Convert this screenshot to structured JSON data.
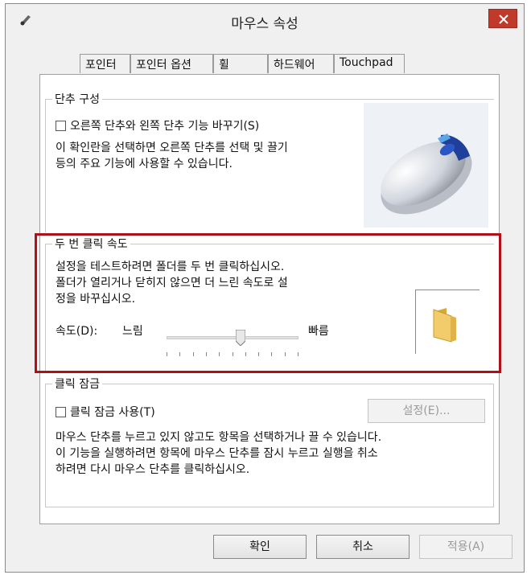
{
  "window": {
    "title": "마우스 속성"
  },
  "tabs": [
    "포인터",
    "포인터 옵션",
    "휠",
    "하드웨어",
    "Touchpad"
  ],
  "button_config": {
    "legend": "단추 구성",
    "checkbox_label": "오른쪽 단추와 왼쪽 단추 기능 바꾸기(S)",
    "checked": false,
    "description": [
      "이 확인란을 선택하면 오른쪽 단추를 선택 및 끌기",
      "등의 주요 기능에 사용할 수 있습니다."
    ]
  },
  "double_click": {
    "legend": "두 번 클릭 속도",
    "description": [
      "설정을 테스트하려면 폴더를 두 번 클릭하십시오.",
      "폴더가 열리거나 닫히지 않으면 더 느린 속도로 설",
      "정을 바꾸십시오."
    ],
    "speed_label": "속도(D):",
    "slow_label": "느림",
    "fast_label": "빠름",
    "speed_fraction": 0.56
  },
  "click_lock": {
    "legend": "클릭 잠금",
    "checkbox_label": "클릭 잠금 사용(T)",
    "checked": false,
    "settings_button": "설정(E)...",
    "description": [
      "마우스 단추를 누르고 있지 않고도 항목을 선택하거나 끌 수 있습니다.",
      "이 기능을 실행하려면 항목에 마우스 단추를 잠시 누르고 실행을 취소",
      "하려면 다시 마우스 단추를 클릭하십시오."
    ]
  },
  "footer": {
    "ok": "확인",
    "cancel": "취소",
    "apply": "적용(A)"
  },
  "colors": {
    "highlight_border": "#b01018",
    "close_button": "#c0392b"
  }
}
